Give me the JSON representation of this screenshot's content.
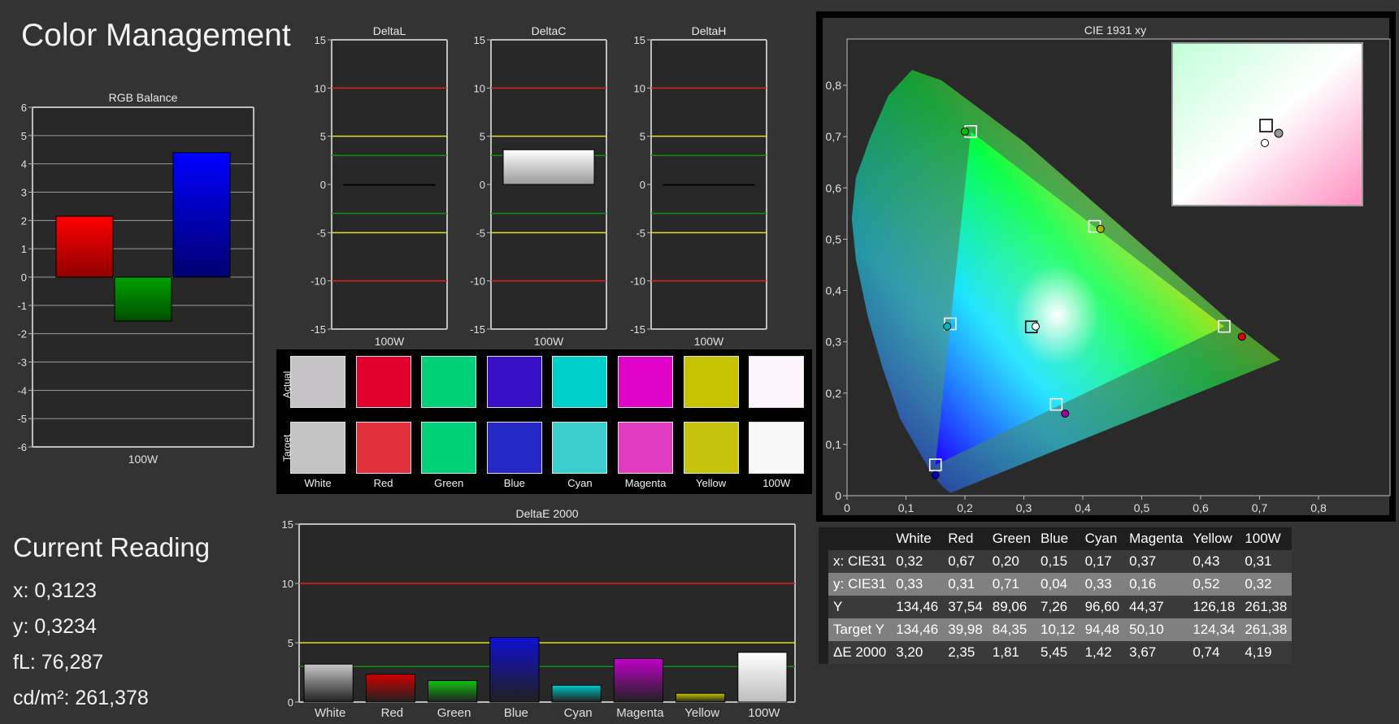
{
  "page": {
    "title": "Color Management"
  },
  "current_reading": {
    "heading": "Current Reading",
    "x": "x: 0,3123",
    "y": "y: 0,3234",
    "fl": "fL: 76,287",
    "cdm2": "cd/m²: 261,378"
  },
  "swatch_panel": {
    "row_labels": [
      "Actual",
      "Target"
    ],
    "labels": [
      "White",
      "Red",
      "Green",
      "Blue",
      "Cyan",
      "Magenta",
      "Yellow",
      "100W"
    ],
    "actual_colors": [
      "#c6c4c6",
      "#e0002a",
      "#00d07a",
      "#3a10c6",
      "#00d0cc",
      "#e004c8",
      "#c6c200",
      "#fdf4fd"
    ],
    "target_colors": [
      "#c2c2c2",
      "#e0303a",
      "#00d07a",
      "#2628c4",
      "#3ccecc",
      "#e03cc0",
      "#c6c210",
      "#f8f8f8"
    ]
  },
  "table": {
    "headers": [
      "",
      "White",
      "Red",
      "Green",
      "Blue",
      "Cyan",
      "Magenta",
      "Yellow",
      "100W"
    ],
    "rows": [
      {
        "label": "x: CIE31",
        "values": [
          "0,32",
          "0,67",
          "0,20",
          "0,15",
          "0,17",
          "0,37",
          "0,43",
          "0,31"
        ]
      },
      {
        "label": "y: CIE31",
        "values": [
          "0,33",
          "0,31",
          "0,71",
          "0,04",
          "0,33",
          "0,16",
          "0,52",
          "0,32"
        ]
      },
      {
        "label": "Y",
        "values": [
          "134,46",
          "37,54",
          "89,06",
          "7,26",
          "96,60",
          "44,37",
          "126,18",
          "261,38"
        ]
      },
      {
        "label": "Target Y",
        "values": [
          "134,46",
          "39,98",
          "84,35",
          "10,12",
          "94,48",
          "50,10",
          "124,34",
          "261,38"
        ]
      },
      {
        "label": "ΔE 2000",
        "values": [
          "3,20",
          "2,35",
          "1,81",
          "5,45",
          "1,42",
          "3,67",
          "0,74",
          "4,19"
        ]
      }
    ]
  },
  "chart_data": [
    {
      "id": "rgb",
      "type": "bar",
      "title": "RGB Balance",
      "categories": [
        "100W"
      ],
      "ylim": [
        -6,
        6
      ],
      "yticks": [
        "6",
        "5",
        "4",
        "3",
        "2",
        "1",
        "0",
        "-1",
        "-2",
        "-3",
        "-4",
        "-5",
        "-6"
      ],
      "series": [
        {
          "values": [
            2.15
          ],
          "color": "#ff0000"
        },
        {
          "values": [
            -1.55
          ],
          "color": "#00a000"
        },
        {
          "values": [
            4.4
          ],
          "color": "#0000ff"
        }
      ]
    },
    {
      "id": "deltaL",
      "type": "bar",
      "title": "DeltaL",
      "categories": [
        "100W"
      ],
      "ylim": [
        -15,
        15
      ],
      "yticks": [
        "15",
        "10",
        "5",
        "0",
        "-5",
        "-10",
        "-15"
      ],
      "values": [
        0.0
      ]
    },
    {
      "id": "deltaC",
      "type": "bar",
      "title": "DeltaC",
      "categories": [
        "100W"
      ],
      "ylim": [
        -15,
        15
      ],
      "yticks": [
        "15",
        "10",
        "5",
        "0",
        "-5",
        "-10",
        "-15"
      ],
      "values": [
        3.6
      ]
    },
    {
      "id": "deltaH",
      "type": "bar",
      "title": "DeltaH",
      "categories": [
        "100W"
      ],
      "ylim": [
        -15,
        15
      ],
      "yticks": [
        "15",
        "10",
        "5",
        "0",
        "-5",
        "-10",
        "-15"
      ],
      "values": [
        0.0
      ]
    },
    {
      "id": "deltaE",
      "type": "bar",
      "title": "DeltaE 2000",
      "categories": [
        "White",
        "Red",
        "Green",
        "Blue",
        "Cyan",
        "Magenta",
        "Yellow",
        "100W"
      ],
      "values": [
        3.2,
        2.35,
        1.81,
        5.45,
        1.42,
        3.67,
        0.74,
        4.19
      ],
      "colors": [
        "#c8c8c8",
        "#d00000",
        "#10c010",
        "#1010d0",
        "#00c8c8",
        "#c000c8",
        "#c8c800",
        "#ffffff"
      ],
      "ylim": [
        0,
        15
      ],
      "yticks": [
        "15",
        "10",
        "5",
        "0"
      ]
    },
    {
      "id": "cie",
      "type": "scatter",
      "title": "CIE 1931 xy",
      "xlim": [
        0,
        0.85
      ],
      "ylim": [
        0,
        0.85
      ],
      "xticks": [
        "0",
        "0,1",
        "0,2",
        "0,3",
        "0,4",
        "0,5",
        "0,6",
        "0,7",
        "0,8"
      ],
      "yticks": [
        "0",
        "0,1",
        "0,2",
        "0,3",
        "0,4",
        "0,5",
        "0,6",
        "0,7",
        "0,8"
      ],
      "targets": [
        {
          "name": "Red",
          "x": 0.64,
          "y": 0.33
        },
        {
          "name": "Green",
          "x": 0.21,
          "y": 0.71
        },
        {
          "name": "Blue",
          "x": 0.15,
          "y": 0.06
        },
        {
          "name": "Cyan",
          "x": 0.175,
          "y": 0.335
        },
        {
          "name": "Magenta",
          "x": 0.355,
          "y": 0.178
        },
        {
          "name": "Yellow",
          "x": 0.42,
          "y": 0.525
        },
        {
          "name": "White",
          "x": 0.3127,
          "y": 0.329
        }
      ],
      "actual": [
        {
          "name": "Red",
          "x": 0.67,
          "y": 0.31,
          "color": "#e00000"
        },
        {
          "name": "Green",
          "x": 0.2,
          "y": 0.71,
          "color": "#00c000"
        },
        {
          "name": "Blue",
          "x": 0.15,
          "y": 0.04,
          "color": "#0000c0"
        },
        {
          "name": "Cyan",
          "x": 0.17,
          "y": 0.33,
          "color": "#00b8b8"
        },
        {
          "name": "Magenta",
          "x": 0.37,
          "y": 0.16,
          "color": "#a000a0"
        },
        {
          "name": "Yellow",
          "x": 0.43,
          "y": 0.52,
          "color": "#b0b000"
        },
        {
          "name": "White",
          "x": 0.32,
          "y": 0.33,
          "color": "#ffffff"
        }
      ]
    }
  ]
}
